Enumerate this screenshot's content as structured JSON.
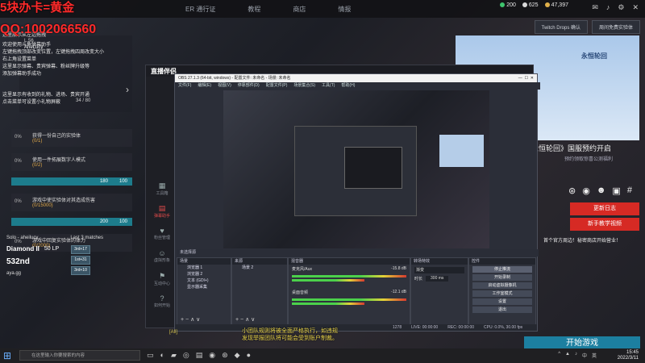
{
  "topnav": {
    "items": [
      "ER 通行证",
      "教程",
      "商店",
      "情报"
    ],
    "currency": [
      {
        "value": "200",
        "color": "#3ec46d"
      },
      {
        "value": "625",
        "color": "#d9d9d9"
      },
      {
        "value": "47,397",
        "color": "#e0b04a"
      }
    ],
    "icons": [
      "mail-icon",
      "bell-icon",
      "settings-icon",
      "close-icon"
    ]
  },
  "watermark": {
    "line1": "5块办卡=黄金",
    "line2": "QQ:1002066560"
  },
  "twitch": {
    "drops": "Twitch Drops 确认",
    "free": "周间免费实验体"
  },
  "chatlog": [
    "这里展示从左边拖拽",
    "欢迎使用斗鱼弹幕助手",
    "左键拖拽顶部改变位置，左键拖拽四周改变大小",
    "右上角设置菜单",
    "这里显示弹幕、贵宾弹幕、粉丝牌升级等",
    "添加弹幕助手成功",
    "这里显示有收到的礼物、进场、贵宾开通",
    "点击菜单可设置小礼物屏蔽"
  ],
  "player": {
    "level": "L.56",
    "name": "AheLucy",
    "bp": "34 / 80"
  },
  "missions": [
    {
      "pct": "0%",
      "name": "获得一份自己的实验体",
      "progress": "(0/1)",
      "reward1": "",
      "reward2": ""
    },
    {
      "pct": "0%",
      "name": "使用一件拓展数字人模式",
      "progress": "(0/2)",
      "reward1": "180",
      "reward2": "100"
    },
    {
      "pct": "0%",
      "name": "游戏中使实验体对其造成伤害",
      "progress": "(0/15000)",
      "reward1": "200",
      "reward2": "100"
    },
    {
      "pct": "0%",
      "name": "游戏中回复实验体的体力",
      "progress": "(0/2000)",
      "reward1": "",
      "reward2": ""
    }
  ],
  "rank": {
    "mode": "Solo - aheilucy",
    "matches_label": "Last 3 matches",
    "tier": "Diamond II",
    "lp": "50 LP",
    "points": "532nd",
    "user": "aya.gg",
    "matches": [
      "3rd+17",
      "1st+31",
      "3rd+10"
    ]
  },
  "ad": {
    "logo": "永恒轮回",
    "title": "《永恒轮回》国服预约开启",
    "sub": "预约领取惊喜公测福利",
    "update_btn": "更新日志",
    "guide_btn": "新手教学视频",
    "news": "首个官方周边！秘密商店开始营业！"
  },
  "start_game": "开始游戏",
  "live": {
    "title": "直播伴侣",
    "nav": [
      "工具箱",
      "弹幕助手",
      "粉丝管理",
      "虚拟形象",
      "互动中心",
      "如何开始"
    ]
  },
  "obs": {
    "title": "OBS 27.1.3 (64-bit, windows) - 配置文件: 未命名 - 场景: 未命名",
    "menu": [
      "文件(F)",
      "编辑(E)",
      "视图(V)",
      "停靠部件(D)",
      "配置文件(P)",
      "场景集合(S)",
      "工具(T)",
      "帮助(H)"
    ],
    "preview_label": "未选择源",
    "scenes_header": "场景",
    "scenes": [
      "浏览器 1",
      "浏览器 2",
      "文本 (GDI+)",
      "显示器采集"
    ],
    "sources_header": "来源",
    "sources": [
      "场景 2"
    ],
    "mixer_header": "混音器",
    "mixer": [
      {
        "name": "桌面音频",
        "db": "-12.1 dB"
      },
      {
        "name": "麦克风/Aux",
        "db": "-15.8 dB"
      }
    ],
    "transition_header": "转场特效",
    "transition": {
      "type": "渐变",
      "duration_label": "时长",
      "duration": "300 ms"
    },
    "controls_header": "控件",
    "controls": [
      "停止推流",
      "开始录制",
      "启动虚拟摄像机",
      "工作室模式",
      "设置",
      "退出"
    ],
    "status": {
      "frames": "1278",
      "live": "LIVE: 00:00:00",
      "rec": "REC: 00:00:00",
      "cpu": "CPU: 0.0%, 30.00 fps"
    }
  },
  "subtitle": {
    "tag": "[All]",
    "line1": "小团队规则将被全面严格执行，如违规",
    "line2": "发现举报团队将可能会受到账户制裁。"
  },
  "taskbar": {
    "search_placeholder": "在这里输入你要搜索的内容",
    "time": "15:45",
    "date": "2022/3/11",
    "tray": [
      "^",
      "中",
      "英"
    ]
  }
}
